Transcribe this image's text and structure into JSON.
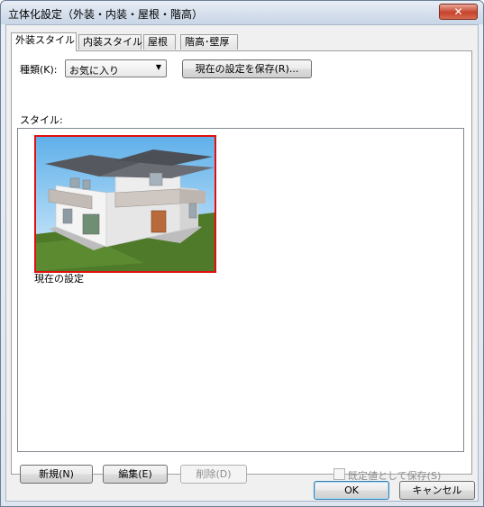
{
  "window": {
    "title": "立体化設定（外装・内装・屋根・階高）",
    "close_label": "✕"
  },
  "tabs": [
    {
      "label": "外装スタイル",
      "active": true
    },
    {
      "label": "内装スタイル",
      "active": false
    },
    {
      "label": "屋根",
      "active": false
    },
    {
      "label": "階高･壁厚",
      "active": false
    }
  ],
  "kind": {
    "label": "種類(K):",
    "value": "お気に入り",
    "save_current_label": "現在の設定を保存(R)..."
  },
  "style": {
    "label": "スタイル:",
    "items": [
      {
        "caption": "現在の設定",
        "selected": true
      }
    ]
  },
  "actions": {
    "new_label": "新規(N)",
    "edit_label": "編集(E)",
    "delete_label": "削除(D)",
    "save_default_label": "既定値として保存(S)",
    "save_default_checked": false
  },
  "footer": {
    "ok_label": "OK",
    "cancel_label": "キャンセル"
  },
  "colors": {
    "selection_border": "#e01010",
    "roof": "#5b5e63",
    "wall": "#f2f2f2",
    "grass": "#4f7a2a",
    "sky": "#7ec1ef"
  }
}
